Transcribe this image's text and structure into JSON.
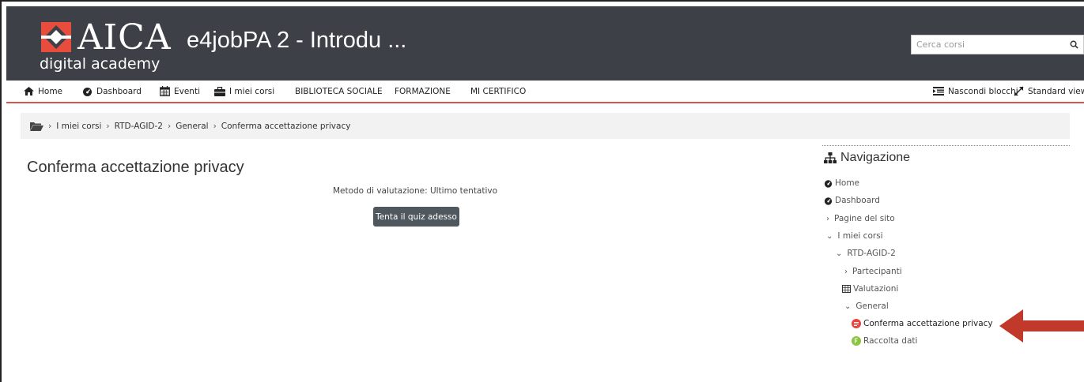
{
  "header": {
    "logo_main": "AICA",
    "logo_sub": "digital academy",
    "site_title": "e4jobPA 2 - Introdu ...",
    "search_placeholder": "Cerca corsi"
  },
  "navbar": {
    "items": [
      {
        "label": "Home",
        "icon": "home-icon"
      },
      {
        "label": "Dashboard",
        "icon": "dashboard-icon"
      },
      {
        "label": "Eventi",
        "icon": "calendar-icon"
      },
      {
        "label": "I miei corsi",
        "icon": "briefcase-icon"
      },
      {
        "label": "BIBLIOTECA SOCIALE"
      },
      {
        "label": "FORMAZIONE"
      },
      {
        "label": "MI CERTIFICO"
      }
    ],
    "right": [
      {
        "label": "Nascondi blocchi",
        "icon": "hide-blocks-icon"
      },
      {
        "label": "Standard view",
        "icon": "expand-arrows-icon"
      }
    ]
  },
  "breadcrumb": {
    "items": [
      "I miei corsi",
      "RTD-AGID-2",
      "General",
      "Conferma accettazione privacy"
    ]
  },
  "main": {
    "title": "Conferma accettazione privacy",
    "grading_method": "Metodo di valutazione: Ultimo tentativo",
    "quiz_button": "Tenta il quiz adesso"
  },
  "navigation_block": {
    "title": "Navigazione",
    "items": [
      {
        "label": "Home"
      },
      {
        "label": "Dashboard"
      },
      {
        "label": "Pagine del sito"
      },
      {
        "label": "I miei corsi"
      },
      {
        "label": "RTD-AGID-2"
      },
      {
        "label": "Partecipanti"
      },
      {
        "label": "Valutazioni"
      },
      {
        "label": "General"
      },
      {
        "label": "Conferma accettazione privacy"
      },
      {
        "label": "Raccolta dati"
      }
    ]
  },
  "colors": {
    "header_bg": "#3d4046",
    "nav_underline": "#d9534f",
    "button_bg": "#4e585e",
    "arrow": "#c0392b",
    "quiz_icon_red": "#e8453c",
    "feedback_icon_green": "#8cc63f"
  }
}
